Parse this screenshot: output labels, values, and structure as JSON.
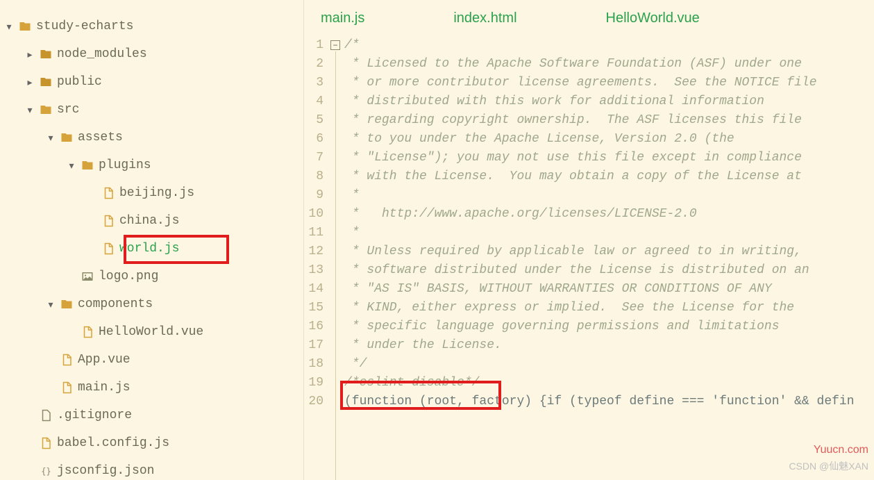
{
  "tabs": [
    "main.js",
    "index.html",
    "HelloWorld.vue"
  ],
  "tree": [
    {
      "indent": 0,
      "chev": "down",
      "icon": "folder-open",
      "label": "study-echarts"
    },
    {
      "indent": 30,
      "chev": "right",
      "icon": "folder",
      "label": "node_modules"
    },
    {
      "indent": 30,
      "chev": "right",
      "icon": "folder",
      "label": "public"
    },
    {
      "indent": 30,
      "chev": "down",
      "icon": "folder-open",
      "label": "src"
    },
    {
      "indent": 60,
      "chev": "down",
      "icon": "folder-open",
      "label": "assets"
    },
    {
      "indent": 90,
      "chev": "down",
      "icon": "folder-open",
      "label": "plugins"
    },
    {
      "indent": 120,
      "chev": "",
      "icon": "js",
      "label": "beijing.js"
    },
    {
      "indent": 120,
      "chev": "",
      "icon": "js",
      "label": "china.js"
    },
    {
      "indent": 120,
      "chev": "",
      "icon": "js",
      "label": "world.js",
      "selected": true
    },
    {
      "indent": 90,
      "chev": "",
      "icon": "img",
      "label": "logo.png"
    },
    {
      "indent": 60,
      "chev": "down",
      "icon": "folder-open",
      "label": "components"
    },
    {
      "indent": 90,
      "chev": "",
      "icon": "vue",
      "label": "HelloWorld.vue"
    },
    {
      "indent": 60,
      "chev": "",
      "icon": "vue",
      "label": "App.vue"
    },
    {
      "indent": 60,
      "chev": "",
      "icon": "js",
      "label": "main.js"
    },
    {
      "indent": 30,
      "chev": "",
      "icon": "file",
      "label": ".gitignore"
    },
    {
      "indent": 30,
      "chev": "",
      "icon": "js",
      "label": "babel.config.js"
    },
    {
      "indent": 30,
      "chev": "",
      "icon": "json",
      "label": "jsconfig.json"
    }
  ],
  "code": {
    "first_line_number": 1,
    "lines": [
      "/*",
      " * Licensed to the Apache Software Foundation (ASF) under one",
      " * or more contributor license agreements.  See the NOTICE file",
      " * distributed with this work for additional information",
      " * regarding copyright ownership.  The ASF licenses this file",
      " * to you under the Apache License, Version 2.0 (the",
      " * \"License\"); you may not use this file except in compliance",
      " * with the License.  You may obtain a copy of the License at",
      " *",
      " *   http://www.apache.org/licenses/LICENSE-2.0",
      " *",
      " * Unless required by applicable law or agreed to in writing,",
      " * software distributed under the License is distributed on an",
      " * \"AS IS\" BASIS, WITHOUT WARRANTIES OR CONDITIONS OF ANY",
      " * KIND, either express or implied.  See the License for the",
      " * specific language governing permissions and limitations",
      " * under the License.",
      " */",
      "/*eslint-disable*/",
      "(function (root, factory) {if (typeof define === 'function' && defin"
    ]
  },
  "watermarks": {
    "top": "Yuucn.com",
    "bottom": "CSDN @仙魅XAN"
  }
}
